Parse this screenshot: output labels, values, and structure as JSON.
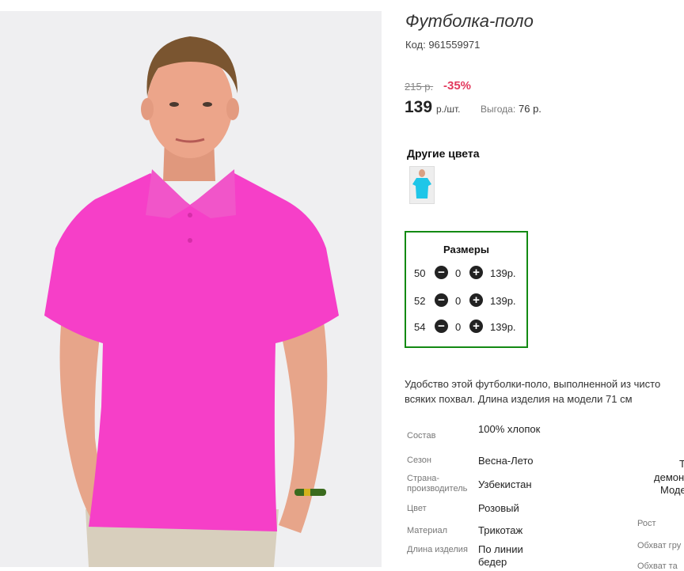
{
  "product": {
    "title": "Футболка-поло",
    "code": "Код: 961559971",
    "old_price": "215 р.",
    "discount": "-35%",
    "price": "139",
    "unit": "р./шт.",
    "benefit_label": "Выгода:",
    "benefit_value": "76 р.",
    "other_colors_label": "Другие цвета",
    "other_colors": [
      {
        "color": "#1fc6e8"
      }
    ],
    "shirt_color": "#f63fc8"
  },
  "sizes": {
    "title": "Размеры",
    "rows": [
      {
        "size": "50",
        "qty": "0",
        "price": "139р."
      },
      {
        "size": "52",
        "qty": "0",
        "price": "139р."
      },
      {
        "size": "54",
        "qty": "0",
        "price": "139р."
      }
    ]
  },
  "description": [
    "Удобство этой футболки-поло, выполненной из чисто",
    "всяких похвал. Длина изделия на модели 71 см"
  ],
  "attributes": [
    {
      "label": "Состав",
      "value": "100% хлопок"
    },
    {
      "label": "Сезон",
      "value": "Весна-Лето"
    },
    {
      "label": "Страна-производитель",
      "value": "Узбекистан"
    },
    {
      "label": "Цвет",
      "value": "Розовый"
    },
    {
      "label": "Материал",
      "value": "Трикотаж"
    },
    {
      "label": "Длина изделия",
      "value": "По линии бедер"
    }
  ],
  "model_params_cut": {
    "line1": "Т",
    "line2": "демон",
    "line3": "Моде",
    "height_label": "Рост",
    "chest_label": "Обхват гру",
    "waist_label": "Обхват та"
  },
  "colors": {
    "accent_border": "#138a13",
    "discount": "#e23a5d",
    "buy_button": "#b4e02c"
  }
}
